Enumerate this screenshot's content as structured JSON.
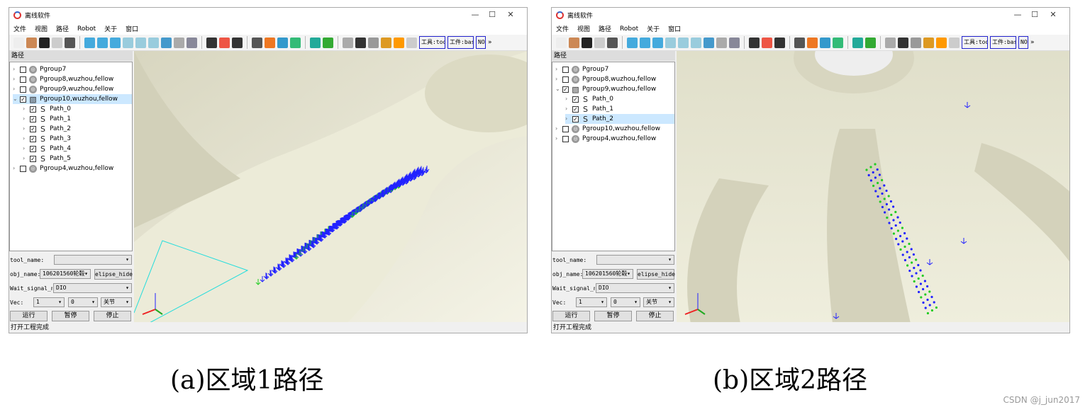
{
  "windows": [
    {
      "id": "a",
      "title": "离线软件",
      "menu": [
        "文件",
        "视图",
        "路径",
        "Robot",
        "关于",
        "窗口"
      ],
      "toolbar_boxes": [
        "工具:too",
        "工件:bas",
        "NO,"
      ],
      "panel_title": "路径",
      "tree": [
        {
          "label": "Pgroup7",
          "level": 0,
          "checked": false,
          "expanded": false,
          "icon": "group-icon"
        },
        {
          "label": "Pgroup8,wuzhou,fellow",
          "level": 0,
          "checked": false,
          "expanded": false,
          "icon": "group-icon"
        },
        {
          "label": "Pgroup9,wuzhou,fellow",
          "level": 0,
          "checked": false,
          "expanded": false,
          "icon": "group-icon"
        },
        {
          "label": "Pgroup10,wuzhou,fellow",
          "level": 0,
          "checked": true,
          "expanded": true,
          "icon": "group-active-icon",
          "selected": true
        },
        {
          "label": "Path_0",
          "level": 1,
          "checked": true,
          "icon": "path-icon"
        },
        {
          "label": "Path_1",
          "level": 1,
          "checked": true,
          "icon": "path-icon"
        },
        {
          "label": "Path_2",
          "level": 1,
          "checked": true,
          "icon": "path-icon"
        },
        {
          "label": "Path_3",
          "level": 1,
          "checked": true,
          "icon": "path-icon"
        },
        {
          "label": "Path_4",
          "level": 1,
          "checked": true,
          "icon": "path-icon"
        },
        {
          "label": "Path_5",
          "level": 1,
          "checked": true,
          "icon": "path-icon"
        },
        {
          "label": "Pgroup4,wuzhou,fellow",
          "level": 0,
          "checked": false,
          "expanded": false,
          "icon": "group-icon"
        }
      ],
      "controls": {
        "tool_name_label": "tool_name:",
        "tool_name_value": "",
        "obj_name_label": "obj_name:",
        "obj_name_value": "106201560轮毂",
        "elipse_button": "elipse_hide",
        "wait_label": "Wait_signal_n:",
        "wait_value": "DIO",
        "vec_label": "Vec:",
        "vec1": "1",
        "vec2": "0",
        "vec3": "关节",
        "run": "运行",
        "pause": "暂停",
        "stop": "停止"
      },
      "status": "打开工程完成"
    },
    {
      "id": "b",
      "title": "离线软件",
      "menu": [
        "文件",
        "视图",
        "路径",
        "Robot",
        "关于",
        "窗口"
      ],
      "toolbar_boxes": [
        "工具:too",
        "工件:bas",
        "NO,"
      ],
      "panel_title": "路径",
      "tree": [
        {
          "label": "Pgroup7",
          "level": 0,
          "checked": false,
          "expanded": false,
          "icon": "group-icon"
        },
        {
          "label": "Pgroup8,wuzhou,fellow",
          "level": 0,
          "checked": false,
          "expanded": false,
          "icon": "group-icon"
        },
        {
          "label": "Pgroup9,wuzhou,fellow",
          "level": 0,
          "checked": true,
          "expanded": true,
          "icon": "group-active-icon"
        },
        {
          "label": "Path_0",
          "level": 1,
          "checked": true,
          "icon": "path-icon"
        },
        {
          "label": "Path_1",
          "level": 1,
          "checked": true,
          "icon": "path-icon"
        },
        {
          "label": "Path_2",
          "level": 1,
          "checked": true,
          "icon": "path-icon",
          "selected": true
        },
        {
          "label": "Pgroup10,wuzhou,fellow",
          "level": 0,
          "checked": false,
          "expanded": false,
          "icon": "group-icon"
        },
        {
          "label": "Pgroup4,wuzhou,fellow",
          "level": 0,
          "checked": false,
          "expanded": false,
          "icon": "group-icon"
        }
      ],
      "controls": {
        "tool_name_label": "tool_name:",
        "tool_name_value": "",
        "obj_name_label": "obj_name:",
        "obj_name_value": "106201560轮毂",
        "elipse_button": "elipse_hide",
        "wait_label": "Wait_signal_n:",
        "wait_value": "DIO",
        "vec_label": "Vec:",
        "vec1": "1",
        "vec2": "0",
        "vec3": "关节",
        "run": "运行",
        "pause": "暂停",
        "stop": "停止"
      },
      "status": "打开工程完成"
    }
  ],
  "window_controls": {
    "minimize": "—",
    "maximize": "☐",
    "close": "✕"
  },
  "toolbar_icons": [
    "new-file",
    "open-model",
    "robot",
    "open-folder",
    "save",
    "|",
    "view-front",
    "view-back",
    "view-left",
    "view-right",
    "view-top",
    "view-bottom",
    "view-iso",
    "zoom",
    "home",
    "|",
    "path",
    "target",
    "frame",
    "|",
    "doc",
    "arm",
    "bot",
    "shield",
    "|",
    "shield2",
    "monitor",
    "|",
    "gripper",
    "palette",
    "gear",
    "axes",
    "sun",
    "diamond"
  ],
  "toolbar_colors": [
    "#eee",
    "#c85",
    "#222",
    "#ccc",
    "#555",
    "|",
    "#4ad",
    "#4ad",
    "#4ad",
    "#9cd",
    "#9cd",
    "#9cd",
    "#49c",
    "#aaa",
    "#889",
    "|",
    "#333",
    "#e54",
    "#333",
    "|",
    "#555",
    "#e72",
    "#39c",
    "#3b7",
    "|",
    "#2a9",
    "#3a3",
    "|",
    "#aaa",
    "#333",
    "#999",
    "#d92",
    "#f90",
    "#ccc"
  ],
  "captions": [
    "(a)区域1路径",
    "(b)区域2路径"
  ],
  "watermark": "CSDN @j_jun2017"
}
